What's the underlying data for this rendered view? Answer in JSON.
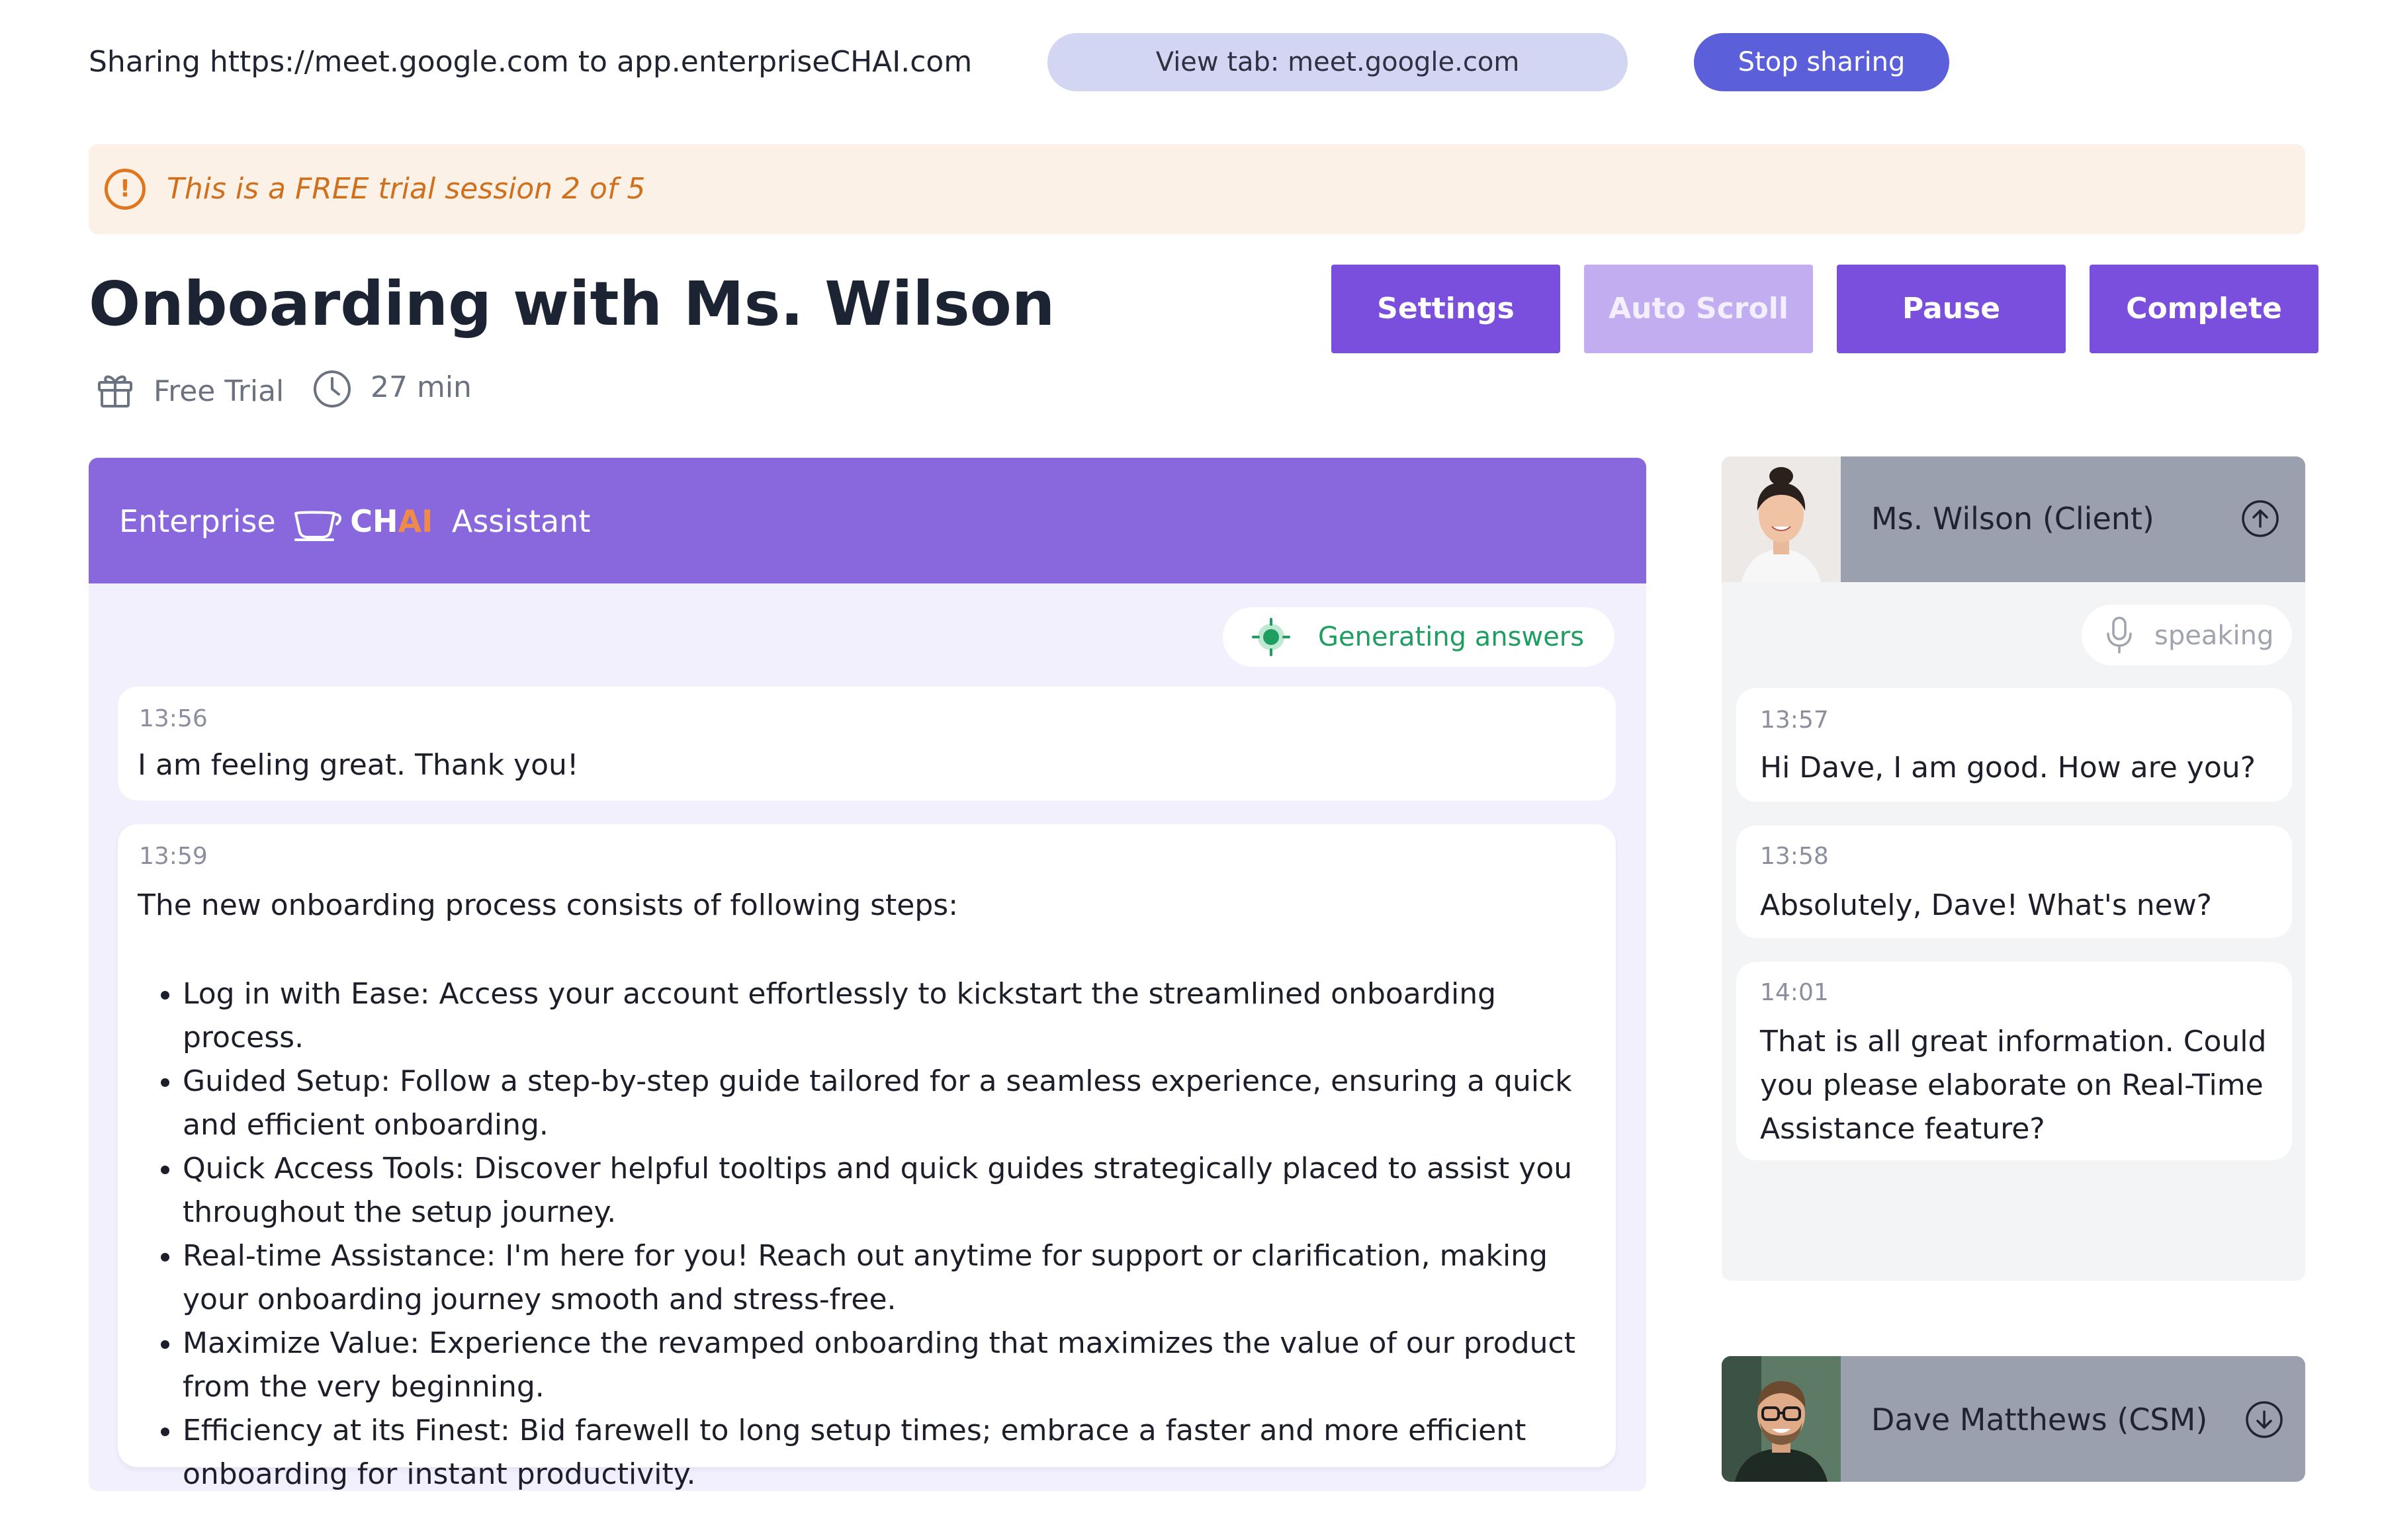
{
  "share_bar": {
    "text": "Sharing https://meet.google.com to app.enterpriseCHAI.com",
    "view_tab": "View tab:  meet.google.com",
    "stop_sharing": "Stop sharing"
  },
  "banner": {
    "icon": "alert-circle-icon",
    "text": "This is a FREE trial session 2 of 5",
    "color": "#d0701c"
  },
  "session": {
    "title": "Onboarding with Ms. Wilson",
    "plan": "Free Trial",
    "duration": "27 min"
  },
  "actions": {
    "settings": "Settings",
    "auto_scroll": "Auto Scroll",
    "pause": "Pause",
    "complete": "Complete"
  },
  "assistant": {
    "brand_prefix": "Enterprise",
    "brand_ch": "CH",
    "brand_ai": "AI",
    "brand_suffix": "Assistant",
    "status": "Generating  answers",
    "messages": [
      {
        "time": "13:56",
        "text": "I am feeling great. Thank you!"
      },
      {
        "time": "13:59",
        "intro": "The new onboarding process consists of following steps:",
        "bullets": [
          "Log in with Ease: Access your account effortlessly to kickstart the streamlined onboarding process.",
          "Guided Setup: Follow a step-by-step guide tailored for a seamless experience, ensuring a quick and efficient onboarding.",
          "Quick Access Tools: Discover helpful tooltips and quick guides strategically placed to assist you throughout the setup journey.",
          "Real-time Assistance: I'm here for you! Reach out anytime for support or clarification, making your onboarding journey smooth and stress-free.",
          "Maximize Value: Experience the revamped onboarding that maximizes the value of our product from the very beginning.",
          "Efficiency at its Finest: Bid farewell to long setup times; embrace a faster and more efficient onboarding for instant productivity."
        ]
      }
    ]
  },
  "client": {
    "name": "Ms. Wilson (Client)",
    "status": "speaking",
    "messages": [
      {
        "time": "13:57",
        "text": "Hi Dave, I am good. How are you?"
      },
      {
        "time": "13:58",
        "text": "Absolutely, Dave! What's new?"
      },
      {
        "time": "14:01",
        "text": "That is all great information. Could you please elaborate on Real-Time Assistance feature?"
      }
    ]
  },
  "csm": {
    "name": "Dave Matthews (CSM)"
  },
  "colors": {
    "accent": "#7a4fdd",
    "accent_disabled": "#c2adf0",
    "header_purple": "#8968de",
    "share_blue": "#5b5fd9",
    "generating_green": "#1f9e61"
  }
}
